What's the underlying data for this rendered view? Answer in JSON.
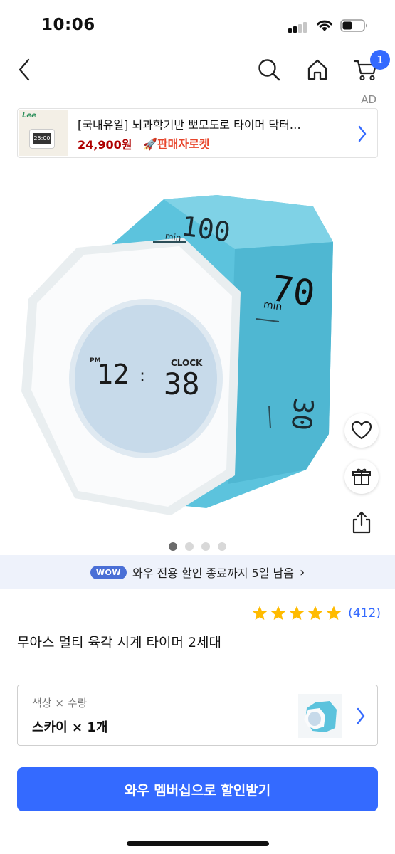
{
  "status_bar": {
    "time": "10:06"
  },
  "nav": {
    "cart_count": "1"
  },
  "ad": {
    "label": "AD",
    "title": "[국내유일] 뇌과학기반 뽀모도로 타이머 닥터…",
    "price": "24,900원",
    "rocket": "🚀판매자로켓",
    "thumb_logo": "Lee",
    "thumb_time": "25:00"
  },
  "product_image": {
    "face_top": "100",
    "face_top_unit": "min",
    "face_right": "70",
    "face_right_unit": "min",
    "face_side": "30",
    "clock_pm": "PM",
    "clock_hour": "12",
    "clock_min": "38",
    "clock_label": "CLOCK",
    "dot_count": 4,
    "active_dot": 0
  },
  "wow": {
    "badge": "WOW",
    "text": "와우 전용 할인 종료까지 5일 남음",
    "chevron": "›"
  },
  "rating": {
    "stars": 5,
    "count": "(412)"
  },
  "product": {
    "title": "무아스 멀티 육각 시계 타이머 2세대"
  },
  "option": {
    "label": "색상 × 수량",
    "value": "스카이 × 1개"
  },
  "cta": {
    "label": "와우 멤버십으로 할인받기"
  },
  "colors": {
    "accent": "#346aff",
    "sky": "#5cc3dd",
    "price_red": "#ae0000",
    "star": "#ffbb00"
  }
}
